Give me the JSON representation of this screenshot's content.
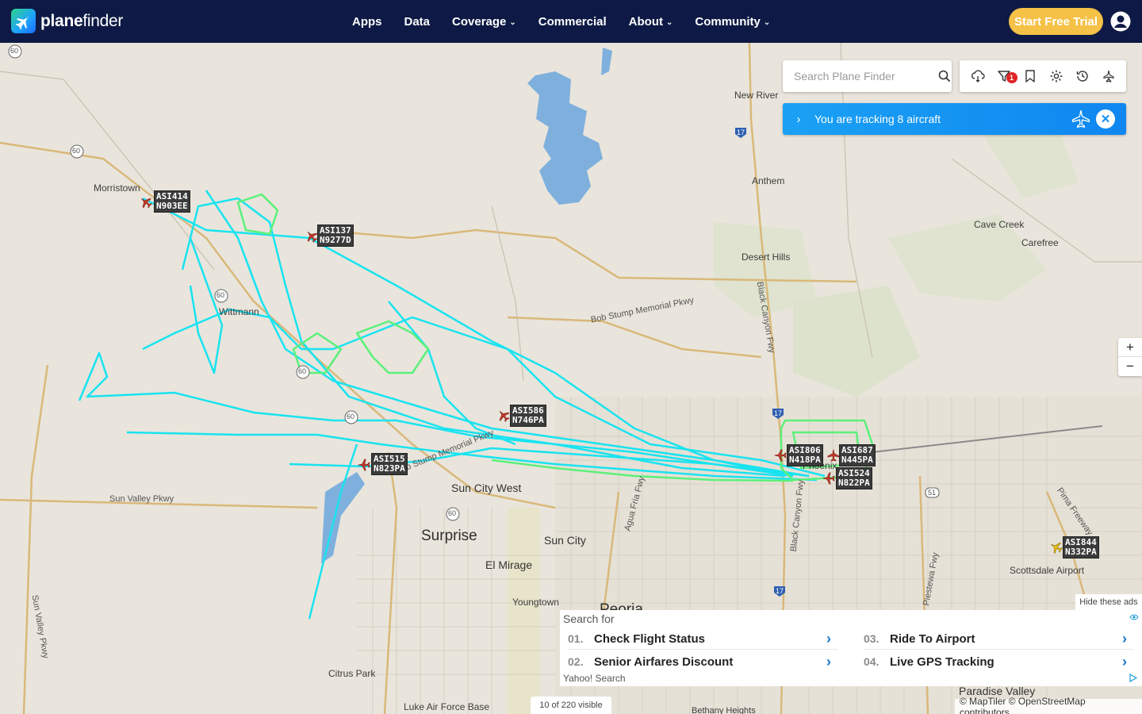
{
  "header": {
    "logo_text_bold": "plane",
    "logo_text_light": "finder",
    "nav": [
      {
        "label": "Apps",
        "dropdown": false
      },
      {
        "label": "Data",
        "dropdown": false
      },
      {
        "label": "Coverage",
        "dropdown": true
      },
      {
        "label": "Commercial",
        "dropdown": false
      },
      {
        "label": "About",
        "dropdown": true
      },
      {
        "label": "Community",
        "dropdown": true
      }
    ],
    "trial_button": "Start Free Trial"
  },
  "search": {
    "placeholder": "Search Plane Finder"
  },
  "toolbar": {
    "filter_badge": "1"
  },
  "tracking": {
    "text": "You are tracking 8 aircraft"
  },
  "zoom": {
    "in": "+",
    "out": "−"
  },
  "places": {
    "morristown": "Morristown",
    "wittmann": "Wittmann",
    "new_river": "New River",
    "anthem": "Anthem",
    "desert_hills": "Desert Hills",
    "cave_creek": "Cave Creek",
    "carefree": "Carefree",
    "sun_city_west": "Sun City West",
    "surprise": "Surprise",
    "sun_city": "Sun City",
    "el_mirage": "El Mirage",
    "youngtown": "Youngtown",
    "peoria": "Peoria",
    "citrus_park": "Citrus Park",
    "luke_afb": "Luke Air Force Base",
    "paradise_valley": "Paradise Valley",
    "scottsdale_airport": "Scottsdale Airport",
    "phoenix": "Phoenix",
    "bethany_heights": "Bethany Heights"
  },
  "roads": {
    "bob_stump": "Bob Stump Memorial Pkwy",
    "bob_stump_2": "Bob Stump Memorial Pkwy",
    "sun_valley_pkwy": "Sun Valley Pkwy",
    "sun_valley_pkwy_v": "Sun Valley Pkwy",
    "black_canyon": "Black Canyon Fwy",
    "black_canyon_2": "Black Canyon Fwy",
    "agua_fria": "Agua Fria Fwy",
    "piestewa": "Piestewa Fwy",
    "pima": "Pima Freeway",
    "us60_a": "60",
    "us60_b": "60",
    "us60_c": "60",
    "us60_d": "60",
    "us60_e": "60",
    "us60_f": "60",
    "i17_a": "17",
    "i17_b": "17",
    "i17_c": "17",
    "sr51": "51"
  },
  "aircraft": [
    {
      "callsign": "ASI414",
      "reg": "N903EE",
      "color": "#c0392b"
    },
    {
      "callsign": "ASI137",
      "reg": "N9277D",
      "color": "#c0392b"
    },
    {
      "callsign": "ASI586",
      "reg": "N746PA",
      "color": "#c0392b"
    },
    {
      "callsign": "ASI515",
      "reg": "N823PA",
      "color": "#c0392b"
    },
    {
      "callsign": "ASI806",
      "reg": "N418PA",
      "color": "#c0392b"
    },
    {
      "callsign": "ASI687",
      "reg": "N445PA",
      "color": "#c0392b"
    },
    {
      "callsign": "ASI524",
      "reg": "N822PA",
      "color": "#c0392b"
    },
    {
      "callsign": "ASI844",
      "reg": "N332PA",
      "color": "#f1c40f"
    }
  ],
  "ads": {
    "hide": "Hide these ads",
    "search_for": "Search for",
    "items": [
      {
        "num": "01.",
        "text": "Check Flight Status"
      },
      {
        "num": "02.",
        "text": "Senior Airfares Discount"
      },
      {
        "num": "03.",
        "text": "Ride To Airport"
      },
      {
        "num": "04.",
        "text": "Live GPS Tracking"
      }
    ],
    "footer": "Yahoo! Search"
  },
  "visible_count": "10 of 220 visible",
  "attribution": "© MapTiler © OpenStreetMap contributors",
  "colors": {
    "nav_bg": "#0e1a45",
    "accent": "#f5c146",
    "track_cyan": "#19e3f0",
    "track_green": "#5cf07a",
    "tracking_bar": "#1aa1f4"
  }
}
